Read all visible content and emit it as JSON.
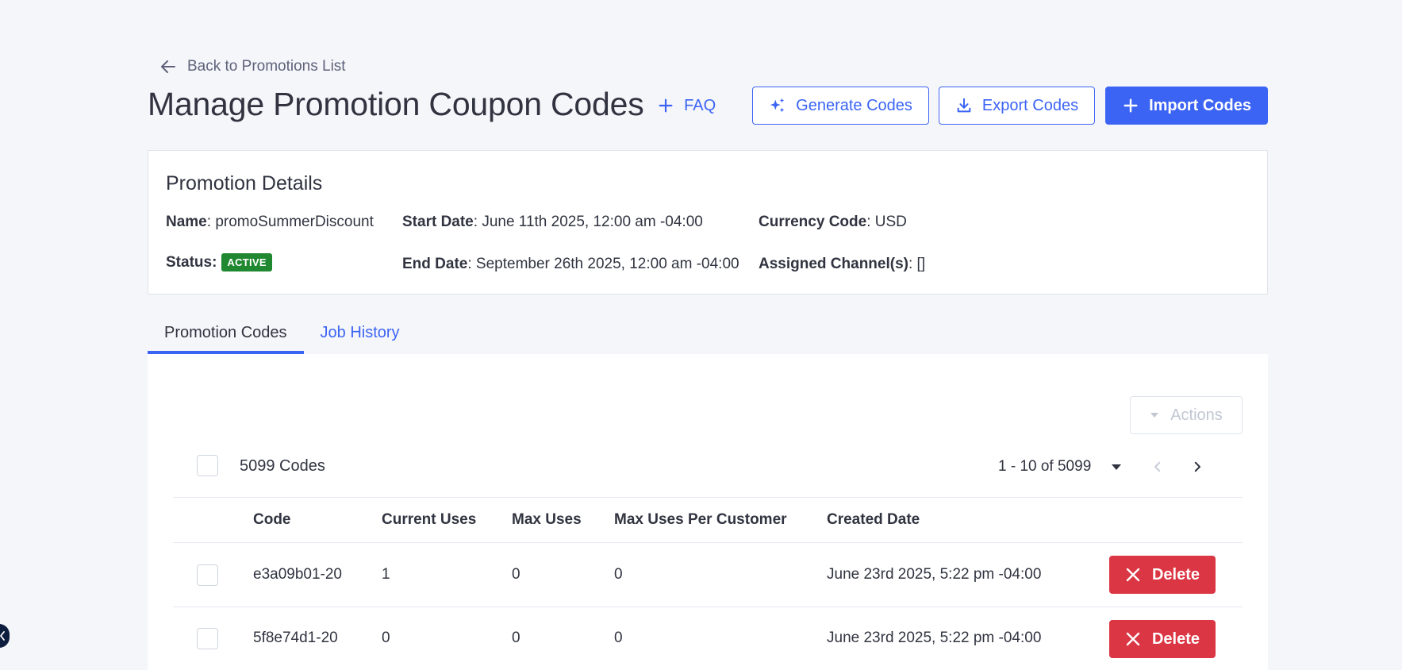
{
  "back_link": {
    "label": "Back to Promotions List"
  },
  "header": {
    "title": "Manage Promotion Coupon Codes",
    "faq_label": "FAQ",
    "generate_label": "Generate Codes",
    "export_label": "Export Codes",
    "import_label": "Import Codes"
  },
  "details": {
    "title": "Promotion Details",
    "name_label": "Name",
    "name_value": "promoSummerDiscount",
    "status_label": "Status:",
    "status_value": "ACTIVE",
    "start_label": "Start Date",
    "start_value": "June 11th 2025, 12:00 am -04:00",
    "end_label": "End Date",
    "end_value": "September 26th 2025, 12:00 am -04:00",
    "currency_label": "Currency Code",
    "currency_value": "USD",
    "channels_label": "Assigned Channel(s)",
    "channels_value": "[]"
  },
  "tabs": [
    {
      "label": "Promotion Codes",
      "active": true
    },
    {
      "label": "Job History",
      "active": false
    }
  ],
  "table": {
    "actions_label": "Actions",
    "codes_count": "5099 Codes",
    "pagination_range": "1 - 10 of 5099",
    "columns": [
      "Code",
      "Current Uses",
      "Max Uses",
      "Max Uses Per Customer",
      "Created Date"
    ],
    "delete_label": "Delete",
    "rows": [
      {
        "code": "e3a09b01-20",
        "current_uses": "1",
        "max_uses": "0",
        "max_per_customer": "0",
        "created": "June 23rd 2025, 5:22 pm -04:00"
      },
      {
        "code": "5f8e74d1-20",
        "current_uses": "0",
        "max_uses": "0",
        "max_per_customer": "0",
        "created": "June 23rd 2025, 5:22 pm -04:00"
      }
    ]
  },
  "colors": {
    "accent": "#3c64f4",
    "danger": "#db3643",
    "success": "#208831",
    "background": "#f5f6fa"
  },
  "icons": {
    "back": "arrow-left-icon",
    "faq": "plus-icon",
    "generate": "sparkle-icon",
    "export": "download-icon",
    "import": "plus-icon",
    "actions": "caret-down-icon",
    "pagination_per_page": "caret-down-icon",
    "prev": "chevron-left-icon",
    "next": "chevron-right-icon",
    "delete": "close-icon"
  }
}
